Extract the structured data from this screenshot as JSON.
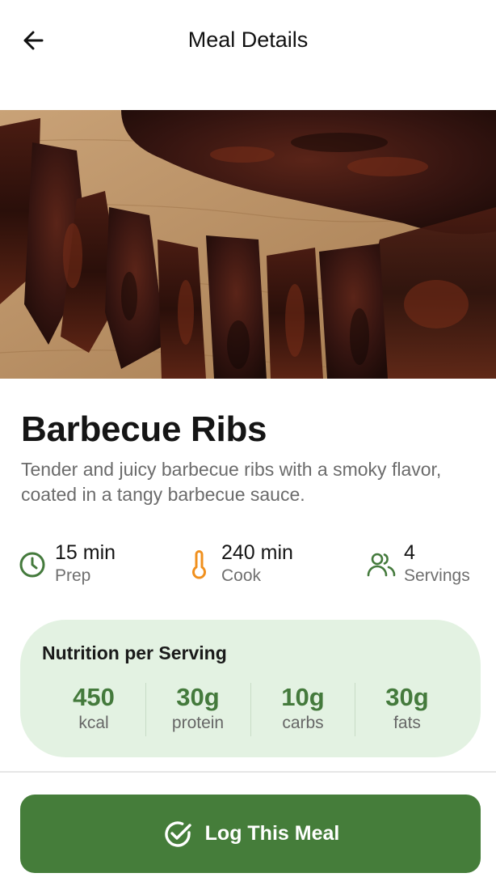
{
  "header": {
    "title": "Meal Details",
    "back_icon": "arrow-left-icon"
  },
  "hero": {
    "image_subject": "barbecue-ribs-photo"
  },
  "meal": {
    "title": "Barbecue Ribs",
    "description": "Tender and juicy barbecue ribs with a smoky flavor, coated in a tangy barbecue sauce."
  },
  "stats": {
    "prep": {
      "value": "15 min",
      "label": "Prep",
      "icon": "clock-icon",
      "color": "#447a3c"
    },
    "cook": {
      "value": "240 min",
      "label": "Cook",
      "icon": "thermometer-icon",
      "color": "#f0901e"
    },
    "servings": {
      "value": "4",
      "label": "Servings",
      "icon": "users-icon",
      "color": "#447a3c"
    }
  },
  "nutrition": {
    "title": "Nutrition per Serving",
    "items": [
      {
        "value": "450",
        "label": "kcal"
      },
      {
        "value": "30g",
        "label": "protein"
      },
      {
        "value": "10g",
        "label": "carbs"
      },
      {
        "value": "30g",
        "label": "fats"
      }
    ]
  },
  "action": {
    "label": "Log This Meal",
    "icon": "check-circle-icon"
  },
  "colors": {
    "accent": "#457d3a",
    "nutrition_bg": "#e3f2e2",
    "nutrition_value": "#447a3c",
    "cook_icon": "#f0901e"
  }
}
